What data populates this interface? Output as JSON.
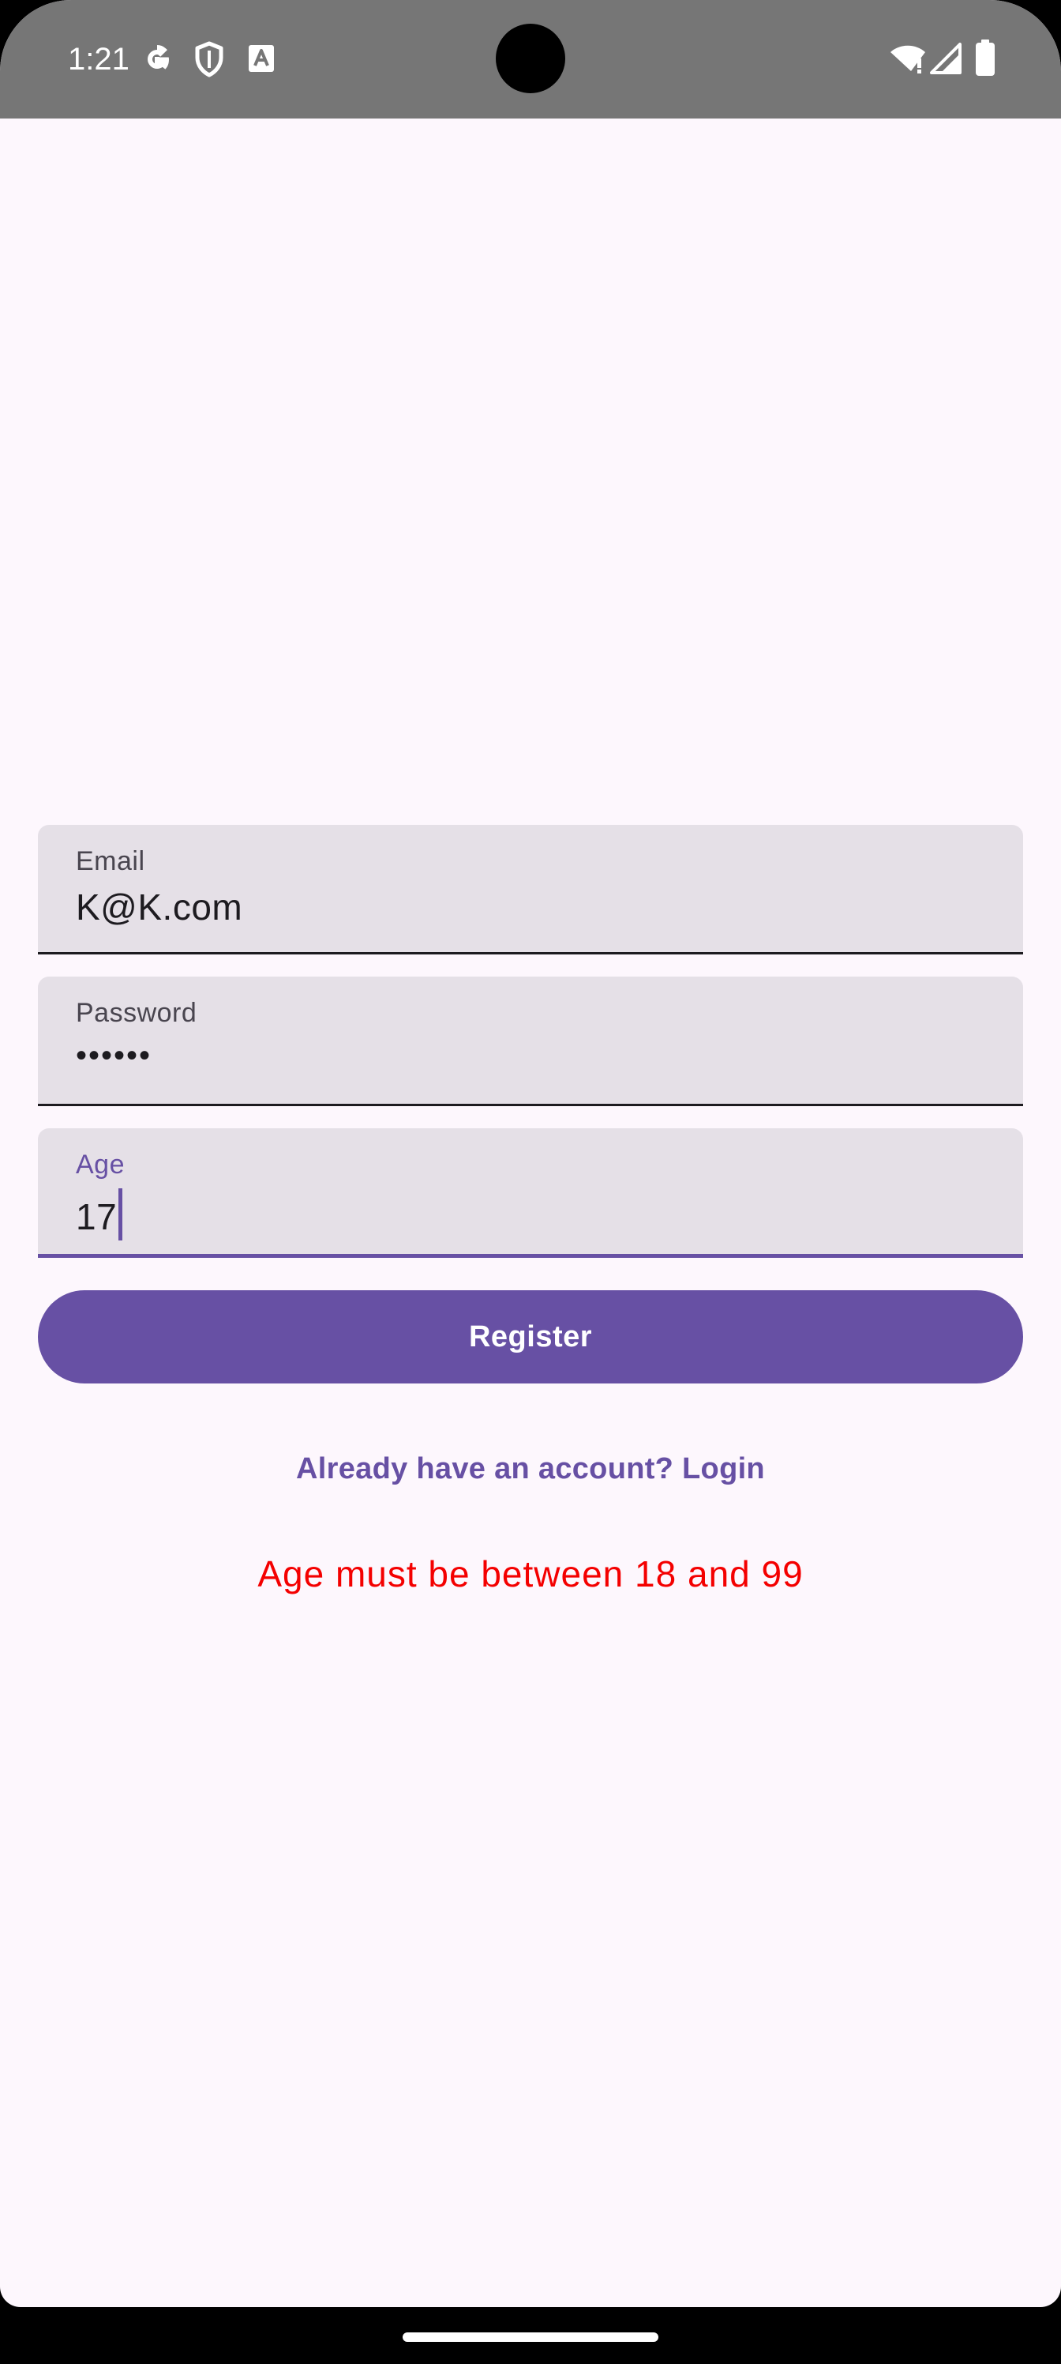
{
  "status_bar": {
    "time": "1:21",
    "icons_left": [
      "google-g-icon",
      "shield-icon",
      "translate-a-icon"
    ],
    "icons_right": [
      "wifi-icon",
      "cell-signal-icon",
      "battery-icon"
    ]
  },
  "form": {
    "email": {
      "label": "Email",
      "value": "K@K.com"
    },
    "password": {
      "label": "Password",
      "value": "••••••"
    },
    "age": {
      "label": "Age",
      "value": "17"
    },
    "register_label": "Register",
    "login_link": "Already have an account? Login",
    "error_message": "Age must be between 18 and 99"
  },
  "colors": {
    "primary": "#6750a4",
    "background": "#fdf7fd",
    "field_background": "#e5e0e7",
    "error": "#f40000",
    "status_bar": "#767676"
  }
}
